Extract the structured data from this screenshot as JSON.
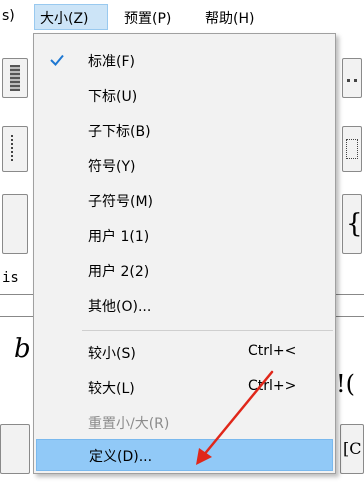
{
  "menubar": {
    "partial_item": "s)",
    "items": [
      {
        "label": "大小(Z)"
      },
      {
        "label": "预置(P)"
      },
      {
        "label": "帮助(H)"
      }
    ]
  },
  "background": {
    "text_is": "is",
    "text_b": "b",
    "text_brace": "{",
    "text_paren": "!(",
    "text_bracket": "[C"
  },
  "menu": {
    "groups": [
      [
        {
          "label": "标准(F)",
          "checked": true
        },
        {
          "label": "下标(U)"
        },
        {
          "label": "子下标(B)"
        },
        {
          "label": "符号(Y)"
        },
        {
          "label": "子符号(M)"
        },
        {
          "label": "用户 1(1)"
        },
        {
          "label": "用户 2(2)"
        },
        {
          "label": "其他(O)..."
        }
      ],
      [
        {
          "label": "较小(S)",
          "shortcut": "Ctrl+<"
        },
        {
          "label": "较大(L)",
          "shortcut": "Ctrl+>"
        },
        {
          "label": "重置小/大(R)",
          "disabled": true
        }
      ],
      [
        {
          "label": "定义(D)...",
          "highlighted": true
        }
      ]
    ]
  },
  "colors": {
    "highlight": "#91c9f7",
    "menu_bg": "#f2f2f2",
    "arrow": "#e0271a",
    "check": "#1e78d2"
  }
}
